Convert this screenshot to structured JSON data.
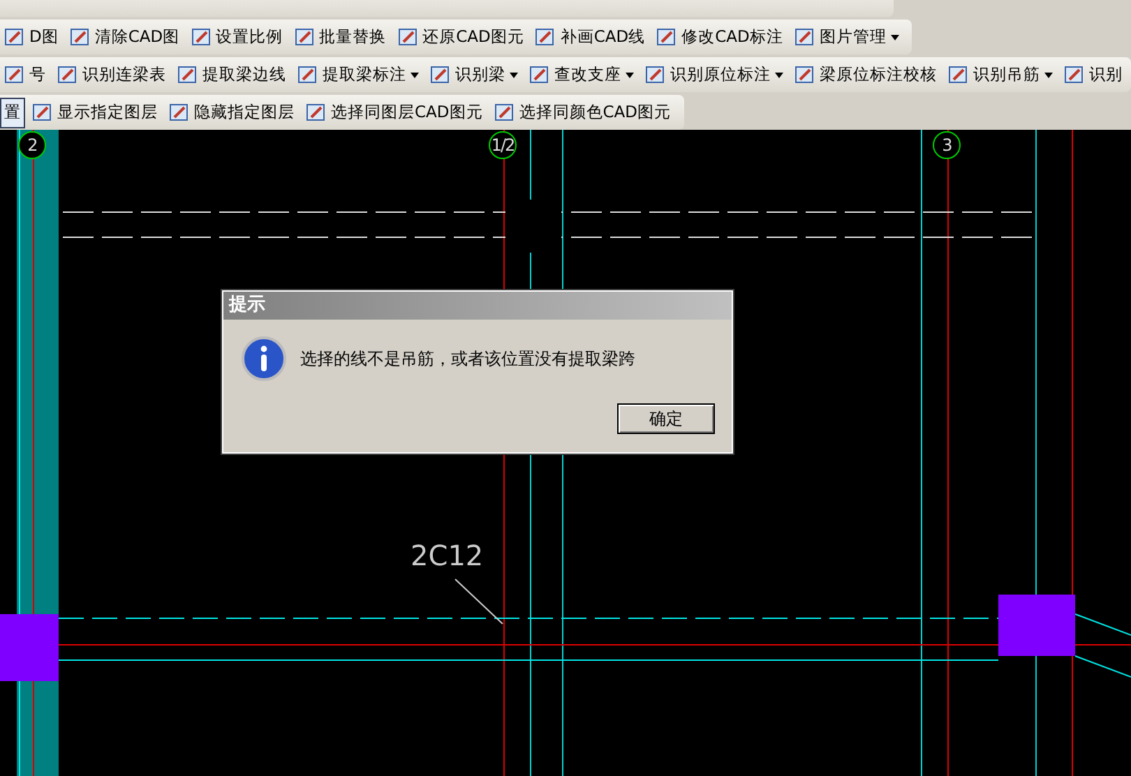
{
  "toolbars": [
    {
      "items": [
        {
          "label": "D图",
          "kind": "tool",
          "dropdown": false
        },
        {
          "label": "清除CAD图",
          "kind": "tool",
          "dropdown": false
        },
        {
          "label": "设置比例",
          "kind": "tool",
          "dropdown": false
        },
        {
          "label": "批量替换",
          "kind": "tool",
          "dropdown": false
        },
        {
          "label": "还原CAD图元",
          "kind": "tool",
          "dropdown": false
        },
        {
          "label": "补画CAD线",
          "kind": "tool",
          "dropdown": false
        },
        {
          "label": "修改CAD标注",
          "kind": "tool",
          "dropdown": false
        },
        {
          "label": "图片管理",
          "kind": "tool",
          "dropdown": true
        }
      ]
    },
    {
      "items": [
        {
          "label": "号",
          "kind": "tool",
          "dropdown": false
        },
        {
          "label": "识别连梁表",
          "kind": "tool",
          "dropdown": false
        },
        {
          "label": "提取梁边线",
          "kind": "tool",
          "dropdown": false
        },
        {
          "label": "提取梁标注",
          "kind": "tool",
          "dropdown": true
        },
        {
          "label": "识别梁",
          "kind": "tool",
          "dropdown": true
        },
        {
          "label": "查改支座",
          "kind": "tool",
          "dropdown": true
        },
        {
          "label": "识别原位标注",
          "kind": "tool",
          "dropdown": true
        },
        {
          "label": "梁原位标注校核",
          "kind": "tool",
          "dropdown": false
        },
        {
          "label": "识别吊筋",
          "kind": "tool",
          "dropdown": true
        },
        {
          "label": "识别",
          "kind": "tool",
          "dropdown": false
        }
      ]
    },
    {
      "items": [
        {
          "label": "置",
          "kind": "pressed",
          "dropdown": false
        },
        {
          "label": "显示指定图层",
          "kind": "tool",
          "dropdown": false
        },
        {
          "label": "隐藏指定图层",
          "kind": "tool",
          "dropdown": false
        },
        {
          "label": "选择同图层CAD图元",
          "kind": "tool",
          "dropdown": false
        },
        {
          "label": "选择同颜色CAD图元",
          "kind": "tool",
          "dropdown": false
        }
      ]
    }
  ],
  "canvas": {
    "axis_labels": [
      "2",
      "1/2",
      "3"
    ],
    "annotation": "2C12"
  },
  "dialog": {
    "title": "提示",
    "message": "选择的线不是吊筋，或者该位置没有提取梁跨",
    "button": "确定"
  }
}
